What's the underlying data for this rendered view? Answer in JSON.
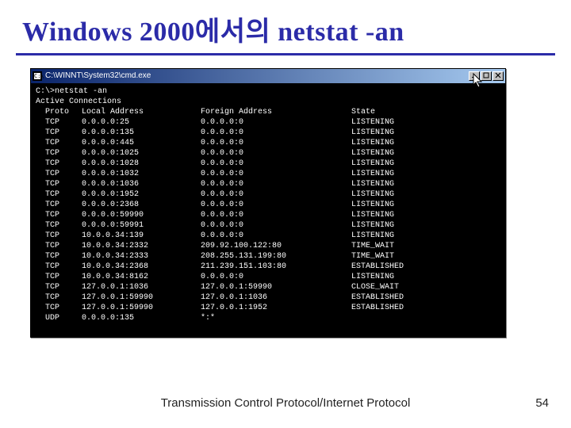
{
  "slide": {
    "title": "Windows 2000에서의 netstat -an",
    "footer": "Transmission Control Protocol/Internet Protocol",
    "page_number": "54"
  },
  "window": {
    "title_text": "C:\\WINNT\\System32\\cmd.exe",
    "min_label": "_",
    "max_label": "□",
    "close_label": "×"
  },
  "console": {
    "prompt_line": "C:\\>netstat -an",
    "blank": "",
    "section_header": "Active Connections",
    "columns": {
      "proto": "Proto",
      "local": "Local Address",
      "foreign": "Foreign Address",
      "state": "State"
    },
    "rows": [
      {
        "proto": "TCP",
        "local": "0.0.0.0:25",
        "foreign": "0.0.0.0:0",
        "state": "LISTENING"
      },
      {
        "proto": "TCP",
        "local": "0.0.0.0:135",
        "foreign": "0.0.0.0:0",
        "state": "LISTENING"
      },
      {
        "proto": "TCP",
        "local": "0.0.0.0:445",
        "foreign": "0.0.0.0:0",
        "state": "LISTENING"
      },
      {
        "proto": "TCP",
        "local": "0.0.0.0:1025",
        "foreign": "0.0.0.0:0",
        "state": "LISTENING"
      },
      {
        "proto": "TCP",
        "local": "0.0.0.0:1028",
        "foreign": "0.0.0.0:0",
        "state": "LISTENING"
      },
      {
        "proto": "TCP",
        "local": "0.0.0.0:1032",
        "foreign": "0.0.0.0:0",
        "state": "LISTENING"
      },
      {
        "proto": "TCP",
        "local": "0.0.0.0:1036",
        "foreign": "0.0.0.0:0",
        "state": "LISTENING"
      },
      {
        "proto": "TCP",
        "local": "0.0.0.0:1952",
        "foreign": "0.0.0.0:0",
        "state": "LISTENING"
      },
      {
        "proto": "TCP",
        "local": "0.0.0.0:2368",
        "foreign": "0.0.0.0:0",
        "state": "LISTENING"
      },
      {
        "proto": "TCP",
        "local": "0.0.0.0:59990",
        "foreign": "0.0.0.0:0",
        "state": "LISTENING"
      },
      {
        "proto": "TCP",
        "local": "0.0.0.0:59991",
        "foreign": "0.0.0.0:0",
        "state": "LISTENING"
      },
      {
        "proto": "TCP",
        "local": "10.0.0.34:139",
        "foreign": "0.0.0.0:0",
        "state": "LISTENING"
      },
      {
        "proto": "TCP",
        "local": "10.0.0.34:2332",
        "foreign": "209.92.100.122:80",
        "state": "TIME_WAIT"
      },
      {
        "proto": "TCP",
        "local": "10.0.0.34:2333",
        "foreign": "208.255.131.199:80",
        "state": "TIME_WAIT"
      },
      {
        "proto": "TCP",
        "local": "10.0.0.34:2368",
        "foreign": "211.239.151.103:80",
        "state": "ESTABLISHED"
      },
      {
        "proto": "TCP",
        "local": "10.0.0.34:8162",
        "foreign": "0.0.0.0:0",
        "state": "LISTENING"
      },
      {
        "proto": "TCP",
        "local": "127.0.0.1:1036",
        "foreign": "127.0.0.1:59990",
        "state": "CLOSE_WAIT"
      },
      {
        "proto": "TCP",
        "local": "127.0.0.1:59990",
        "foreign": "127.0.0.1:1036",
        "state": "ESTABLISHED"
      },
      {
        "proto": "TCP",
        "local": "127.0.0.1:59990",
        "foreign": "127.0.0.1:1952",
        "state": "ESTABLISHED"
      },
      {
        "proto": "UDP",
        "local": "0.0.0.0:135",
        "foreign": "*:*",
        "state": ""
      }
    ]
  }
}
